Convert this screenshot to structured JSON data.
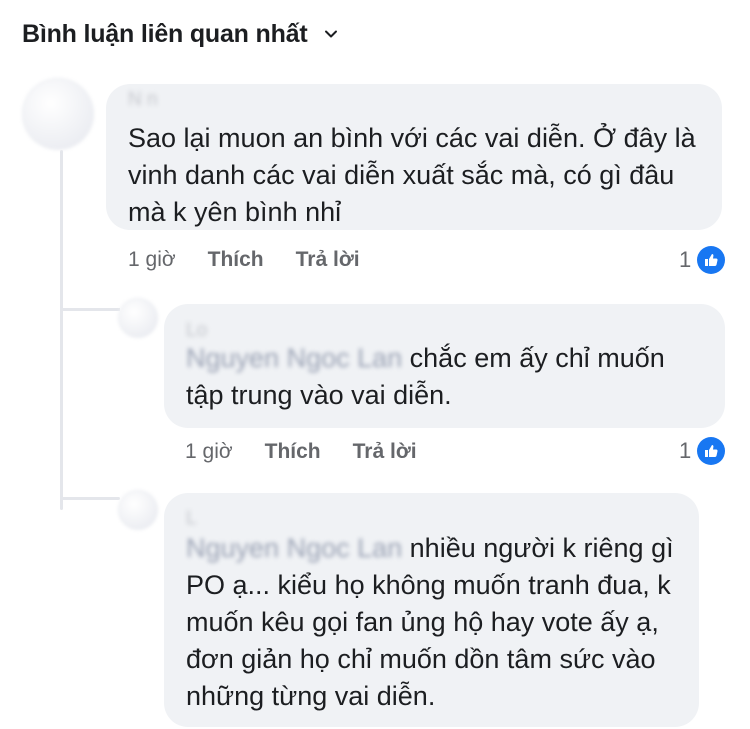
{
  "sort": {
    "label": "Bình luận liên quan nhất",
    "icon": "chevron-down-icon"
  },
  "colors": {
    "like_blue": "#1877f2",
    "bubble_bg": "#f0f2f5",
    "secondary_text": "#65676b"
  },
  "comments": [
    {
      "author": "N                 n",
      "text": "Sao lại muon an bình với các vai diễn. Ở đây là vinh danh các vai diễn xuất sắc mà, có gì đâu mà k yên bình nhỉ",
      "time": "1 giờ",
      "like": "Thích",
      "reply": "Trả lời",
      "reactions": "1"
    }
  ],
  "replies": [
    {
      "author": "Lo",
      "mention": "Nguyen Ngoc Lan",
      "text": " chắc em ấy chỉ muốn tập trung vào vai diễn.",
      "time": "1 giờ",
      "like": "Thích",
      "reply": "Trả lời",
      "reactions": "1"
    },
    {
      "author": "L",
      "mention": "Nguyen Ngoc Lan",
      "text": " nhiều người k riêng gì PO ạ... kiểu họ không muốn tranh đua, k muốn kêu gọi fan ủng hộ hay vote ấy ạ, đơn giản họ chỉ muốn dồn tâm sức vào những từng vai diễn."
    }
  ]
}
